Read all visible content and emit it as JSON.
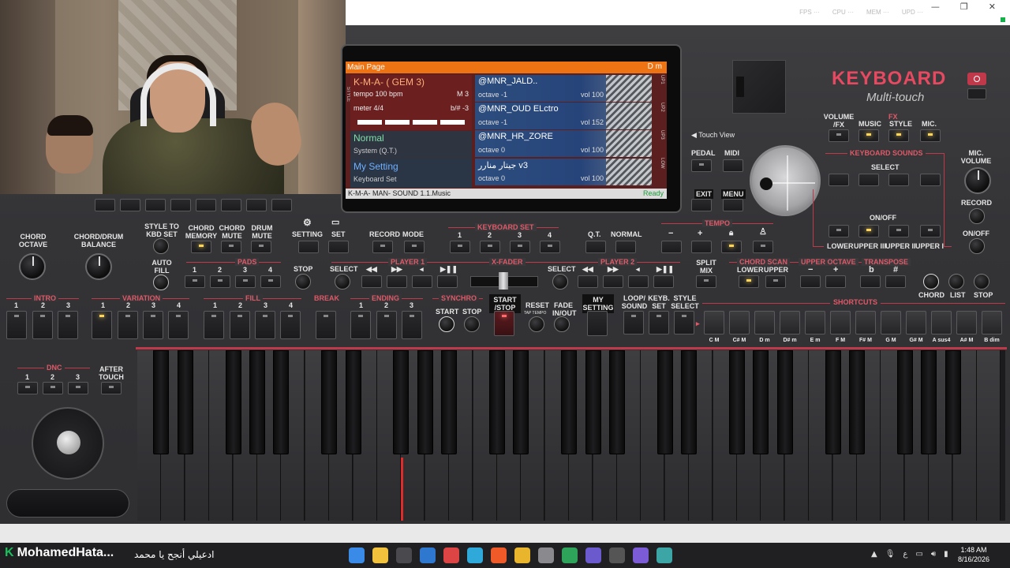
{
  "window": {
    "minimize": "—",
    "restore": "❐",
    "close": "✕",
    "stats": [
      "FPS ···",
      "CPU ···",
      "MEM ···",
      "UPD ···"
    ]
  },
  "lcd": {
    "title": "Main Page",
    "chord": "D m",
    "style": {
      "name": "K-M-A- ( GEM 3)",
      "tempo": "tempo 100 bpm",
      "measure": "M 3",
      "meter": "meter 4/4",
      "transpose": "b/# -3"
    },
    "performance": {
      "name": "Normal",
      "sub": "System (Q.T.)"
    },
    "my_setting": {
      "name": "My Setting",
      "sub": "Keyboard Set"
    },
    "side_labels": [
      "STYLE",
      "SET"
    ],
    "sounds": [
      {
        "name": "@MNR_JALD..",
        "octave": "octave -1",
        "vol": "vol 100",
        "tag": "UP1"
      },
      {
        "name": "@MNR_OUD ELctro",
        "octave": "octave -1",
        "vol": "vol 152",
        "tag": "UP2"
      },
      {
        "name": "@MNR_HR_ZORE",
        "octave": "octave 0",
        "vol": "vol 100",
        "tag": "UP3"
      },
      {
        "name": "جيتار منارر v3",
        "octave": "octave 0",
        "vol": "vol 100",
        "tag": "LOW"
      }
    ],
    "footer": "K-M-A- MAN- SOUND 1.1.Music",
    "status": "Ready"
  },
  "brand": {
    "title": "KEYBOARD",
    "subtitle": "Multi-touch"
  },
  "top_right": {
    "touch_view": "Touch View",
    "volume_fx": "VOLUME /FX",
    "fx": "FX",
    "music": "MUSIC",
    "style": "STYLE",
    "mic": "MIC.",
    "pedal": "PEDAL",
    "midi": "MIDI",
    "exit": "EXIT",
    "menu": "MENU",
    "keyboard_sounds": "KEYBOARD SOUNDS",
    "select": "SELECT",
    "on_off": "ON/OFF",
    "lower": "LOWER",
    "upper3": "UPPER III",
    "upper2": "UPPER II",
    "upper1": "UPPER I",
    "mic_volume": "MIC. VOLUME",
    "record": "RECORD",
    "mic_on_off": "ON/OFF"
  },
  "panel": {
    "chord_octave": "CHORD OCTAVE",
    "chord_drum_balance": "CHORD/DRUM BALANCE",
    "style_to_kbd": "STYLE TO KBD SET",
    "chord_memory": "CHORD MEMORY",
    "chord_mute": "CHORD MUTE",
    "drum_mute": "DRUM MUTE",
    "setting": "SETTING",
    "set": "SET",
    "record": "RECORD",
    "mode": "MODE",
    "keyboard_set": "KEYBOARD SET",
    "kbd_nums": [
      "1",
      "2",
      "3",
      "4"
    ],
    "qt": "Q.T.",
    "normal": "NORMAL",
    "tempo": "TEMPO",
    "tempo_minus": "−",
    "tempo_plus": "+",
    "auto_fill": "AUTO FILL",
    "pads": "PADS",
    "pad_nums": [
      "1",
      "2",
      "3",
      "4"
    ],
    "stop": "STOP",
    "player1": "PLAYER 1",
    "select": "SELECT",
    "xfader": "X-FADER",
    "player2": "PLAYER 2",
    "split_mix": "SPLIT MIX",
    "chord_scan": "CHORD SCAN",
    "upper_octave": "UPPER OCTAVE",
    "transpose": "TRANSPOSE",
    "lower": "LOWER",
    "upper": "UPPER",
    "oct_minus": "−",
    "oct_plus": "+",
    "flat": "b",
    "sharp": "#",
    "chord": "CHORD",
    "list": "LIST",
    "stop2": "STOP",
    "intro": "INTRO",
    "variation": "VARIATION",
    "fill": "FILL",
    "break": "BREAK",
    "ending": "ENDING",
    "synchro": "SYNCHRO",
    "start_stop": "START /STOP",
    "start": "START",
    "sync_stop": "STOP",
    "reset": "RESET",
    "tap_tempo": "TAP TEMPO",
    "fade": "FADE IN/OUT",
    "my_setting": "MY SETTING",
    "loop_sound": "LOOP/ SOUND",
    "keyb_set": "KEYB. SET",
    "style_select": "STYLE SELECT",
    "shortcuts": "SHORTCUTS",
    "nums3": [
      "1",
      "2",
      "3"
    ],
    "nums4": [
      "1",
      "2",
      "3",
      "4"
    ],
    "dnc": "DNC",
    "after_touch": "AFTER TOUCH"
  },
  "shortcuts": [
    "C M",
    "C# M",
    "D m",
    "D# m",
    "E m",
    "F M",
    "F# M",
    "G M",
    "G# M",
    "A sus4",
    "A# M",
    "B dim"
  ],
  "taskbar": {
    "name": "MohamedHata...",
    "message": "ادعيلي أنجح يا محمد",
    "tray_lang": "ع",
    "time": "1:48 AM",
    "date": "8/16/2026"
  }
}
